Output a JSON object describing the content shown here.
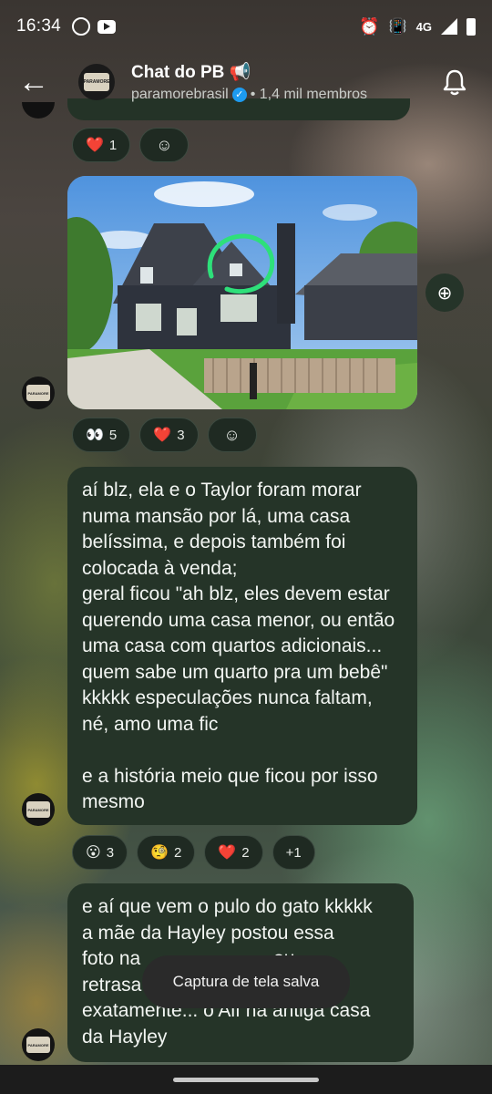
{
  "status_bar": {
    "time": "16:34",
    "network": "4G",
    "left_icons": [
      "whatsapp-icon",
      "youtube-icon"
    ],
    "right_icons": [
      "alarm-icon",
      "vibrate-icon",
      "signal-icon",
      "battery-icon"
    ]
  },
  "header": {
    "title": "Chat do PB 📢",
    "channel": "paramorebrasil",
    "members": "• 1,4 mil membros",
    "avatar_text": "PARAMORE"
  },
  "messages": [
    {
      "type": "image",
      "reactions": [
        {
          "emoji": "👀",
          "count": "5"
        },
        {
          "emoji": "❤️",
          "count": "3"
        }
      ]
    },
    {
      "type": "text",
      "text": "aí blz, ela e o Taylor foram morar numa mansão por lá, uma casa belíssima, e depois também foi colocada à venda;\ngeral ficou \"ah blz, eles devem estar querendo uma casa menor, ou então uma casa com quartos adicionais... quem sabe um quarto pra um bebê\" kkkkk especulações nunca faltam, né, amo uma fic\n\ne a história meio que ficou por isso mesmo",
      "reactions": [
        {
          "emoji": "😮",
          "count": "3"
        },
        {
          "emoji": "🧐",
          "count": "2"
        },
        {
          "emoji": "❤️",
          "count": "2"
        },
        {
          "emoji": "",
          "count": "+1"
        }
      ]
    },
    {
      "type": "text",
      "text": "e aí que vem o pulo do gato kkkkk\na mãe da Hayley postou essa\nfoto na                         ou\nretrasa                              rdo\nexatamente... o Alf na antiga casa\nda Hayley"
    }
  ],
  "previous_reactions": [
    {
      "emoji": "❤️",
      "count": "1"
    }
  ],
  "toast": "Captura de tela salva",
  "colors": {
    "bubble": "#253428",
    "verified": "#1d9bf0",
    "circle_annotation": "#2ee07a"
  }
}
